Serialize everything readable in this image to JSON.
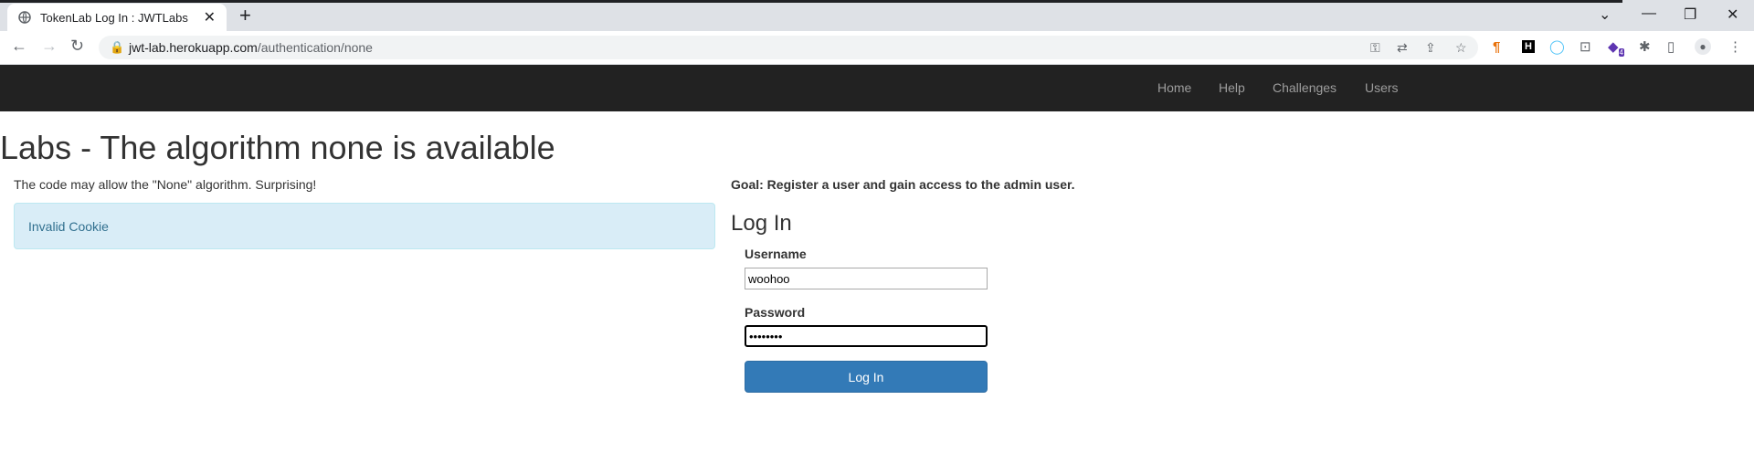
{
  "browser": {
    "tab_title": "TokenLab Log In : JWTLabs",
    "url_host": "jwt-lab.herokuapp.com",
    "url_path": "/authentication/none",
    "ext_badge": "4"
  },
  "nav": {
    "items": [
      "Home",
      "Help",
      "Challenges",
      "Users"
    ]
  },
  "page": {
    "title": "Labs - The algorithm none is available",
    "description": "The code may allow the \"None\" algorithm. Surprising!",
    "alert": "Invalid Cookie",
    "goal": "Goal: Register a user and gain access to the admin user."
  },
  "login": {
    "heading": "Log In",
    "username_label": "Username",
    "username_value": "woohoo",
    "password_label": "Password",
    "password_value": "••••••••",
    "button_label": "Log In"
  }
}
